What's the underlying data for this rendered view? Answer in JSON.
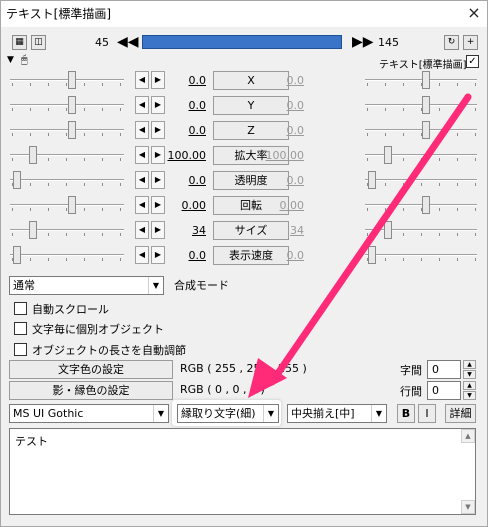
{
  "window": {
    "title": "テキスト[標準描画]",
    "close_glyph": "×"
  },
  "timeline": {
    "start": "45",
    "end": "145",
    "position_fraction": 0.5
  },
  "object_label": "テキスト[標準描画]",
  "params": [
    {
      "label": "X",
      "value": "0.0",
      "end_value": "0.0",
      "start_pos": 0.55,
      "end_pos": 0.55
    },
    {
      "label": "Y",
      "value": "0.0",
      "end_value": "0.0",
      "start_pos": 0.55,
      "end_pos": 0.55
    },
    {
      "label": "Z",
      "value": "0.0",
      "end_value": "0.0",
      "start_pos": 0.55,
      "end_pos": 0.55
    },
    {
      "label": "拡大率",
      "value": "100.00",
      "end_value": "100.00",
      "start_pos": 0.18,
      "end_pos": 0.18
    },
    {
      "label": "透明度",
      "value": "0.0",
      "end_value": "0.0",
      "start_pos": 0.03,
      "end_pos": 0.03
    },
    {
      "label": "回転",
      "value": "0.00",
      "end_value": "0.00",
      "start_pos": 0.55,
      "end_pos": 0.55
    },
    {
      "label": "サイズ",
      "value": "34",
      "end_value": "34",
      "start_pos": 0.18,
      "end_pos": 0.18
    },
    {
      "label": "表示速度",
      "value": "0.0",
      "end_value": "0.0",
      "start_pos": 0.03,
      "end_pos": 0.03
    }
  ],
  "blend": {
    "value": "通常",
    "label": "合成モード"
  },
  "checks": [
    {
      "label": "自動スクロール"
    },
    {
      "label": "文字毎に個別オブジェクト"
    },
    {
      "label": "オブジェクトの長さを自動調節"
    }
  ],
  "color": {
    "text_btn": "文字色の設定",
    "text_rgb": "RGB ( 255 , 255 , 255 )",
    "shadow_btn": "影・縁色の設定",
    "shadow_rgb": "RGB ( 0 , 0 , 0 )"
  },
  "spacing": {
    "char_label": "字間",
    "char_value": "0",
    "line_label": "行間",
    "line_value": "0"
  },
  "font": {
    "family": "MS UI Gothic",
    "deco": "縁取り文字(細)",
    "align": "中央揃え[中]",
    "bold": "B",
    "italic": "I",
    "detail": "詳細"
  },
  "text_content": "テスト",
  "annotation": {
    "arrow_color": "#ff2a78"
  },
  "colors": {
    "seek_fill": "#3a74c8",
    "window_bg": "#f0f0f0"
  }
}
